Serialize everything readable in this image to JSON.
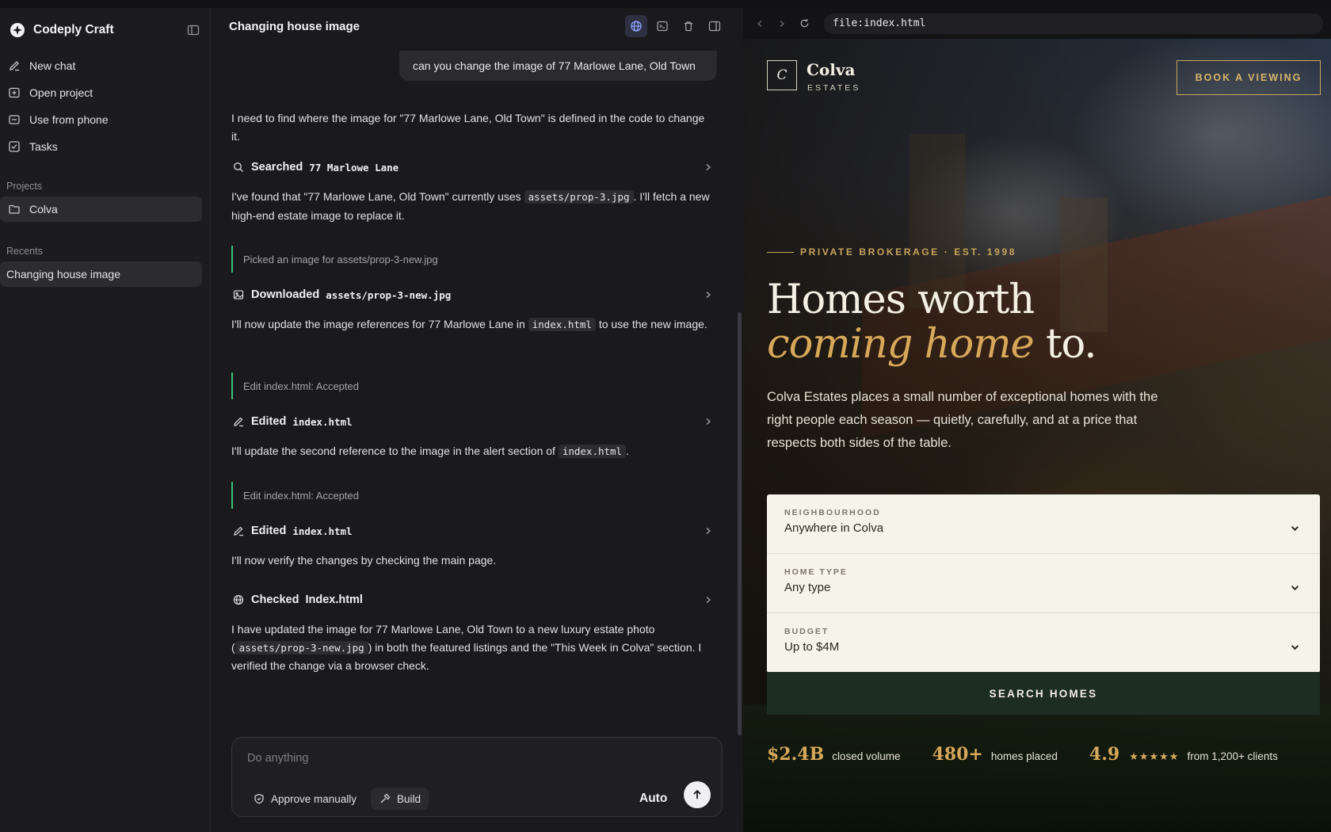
{
  "app": {
    "name": "Codeply Craft"
  },
  "sidebar": {
    "items": [
      {
        "label": "New chat",
        "icon": "pencil-icon"
      },
      {
        "label": "Open project",
        "icon": "folder-plus-icon"
      },
      {
        "label": "Use from phone",
        "icon": "phone-icon"
      },
      {
        "label": "Tasks",
        "icon": "checkbox-icon"
      }
    ],
    "projects_label": "Projects",
    "projects": [
      {
        "label": "Colva"
      }
    ],
    "recents_label": "Recents",
    "recents": [
      {
        "label": "Changing house image"
      }
    ]
  },
  "chat": {
    "title": "Changing house image",
    "user_message": "can you change the image of 77 Marlowe Lane, Old Town",
    "messages": {
      "m1": "I need to find where the image for \"77 Marlowe Lane, Old Town\" is defined in the code to change it.",
      "tool1_verb": "Searched",
      "tool1_arg": "77 Marlowe Lane",
      "m2a": "I've found that \"77 Marlowe Lane, Old Town\" currently uses ",
      "m2_chip": "assets/prop-3.jpg",
      "m2b": ". I'll fetch a new high-end estate image to replace it.",
      "note1": "Picked an image for assets/prop-3-new.jpg",
      "tool2_verb": "Downloaded",
      "tool2_arg": "assets/prop-3-new.jpg",
      "m3a": "I'll now update the image references for 77 Marlowe Lane in ",
      "m3_chip": "index.html",
      "m3b": " to use the new image.",
      "note2": "Edit index.html: Accepted",
      "tool3_verb": "Edited",
      "tool3_arg": "index.html",
      "m4a": "I'll update the second reference to the image in the alert section of ",
      "m4_chip": "index.html",
      "m4b": ".",
      "note3": "Edit index.html: Accepted",
      "tool4_verb": "Edited",
      "tool4_arg": "index.html",
      "m5": "I'll now verify the changes by checking the main page.",
      "tool5_verb": "Checked",
      "tool5_arg": "Index.html",
      "m6a": "I have updated the image for 77 Marlowe Lane, Old Town to a new luxury estate photo (",
      "m6_chip": "assets/prop-3-new.jpg",
      "m6b": ") in both the featured listings and the \"This Week in Colva\" section. I verified the change via a browser check."
    },
    "composer": {
      "placeholder": "Do anything",
      "approve": "Approve manually",
      "build": "Build",
      "mode": "Auto"
    }
  },
  "browser": {
    "url": "file:index.html",
    "site": {
      "logo_letter": "C",
      "brand": "Colva",
      "brand_sub": "ESTATES",
      "book": "BOOK A VIEWING",
      "eyebrow": "PRIVATE BROKERAGE · EST. 1998",
      "headline_1": "Homes worth",
      "headline_2_gold": "coming home",
      "headline_2_white": " to.",
      "lede": "Colva Estates places a small number of exceptional homes with the right people each season — quietly, carefully, and at a price that respects both sides of the table.",
      "fields": [
        {
          "label": "NEIGHBOURHOOD",
          "value": "Anywhere in Colva"
        },
        {
          "label": "HOME TYPE",
          "value": "Any type"
        },
        {
          "label": "BUDGET",
          "value": "Up to $4M"
        }
      ],
      "search": "SEARCH HOMES",
      "stats": {
        "s1_num": "$2.4B",
        "s1_lab": "closed volume",
        "s2_num": "480+",
        "s2_lab": "homes placed",
        "s3_num": "4.9",
        "s3_stars": "★★★★★",
        "s3_lab": "from 1,200+ clients"
      }
    }
  },
  "colors": {
    "accent_gold": "#c9a45c",
    "note_green": "#3cbf7b",
    "search_button": "#1d2d22"
  }
}
